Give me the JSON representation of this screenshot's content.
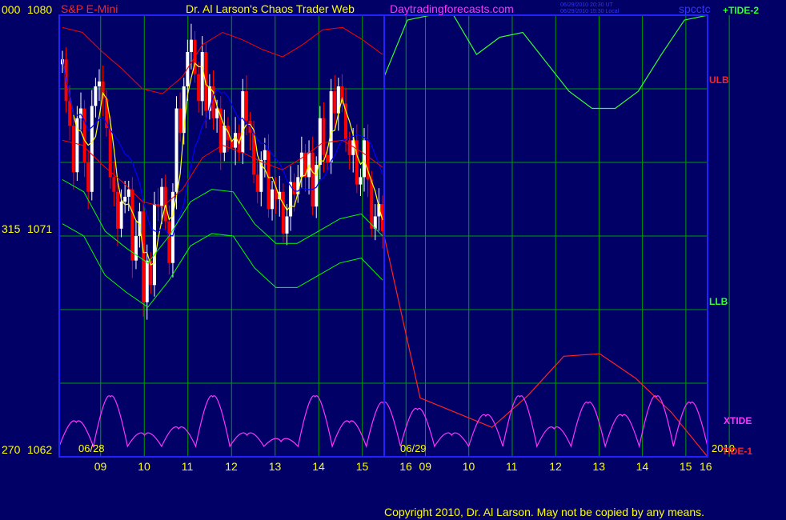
{
  "header": {
    "symbol": "S&P E-Mini",
    "title": "Dr. Al Larson's Chaos Trader Web",
    "site": "Daytradingforecasts.com",
    "timestamp_ut": "06/29/2010 20:30 UT",
    "timestamp_local": "06/29/2010 15:30 Local",
    "chart_id": "spcctc",
    "tide2_label": "+TIDE-2"
  },
  "footer": {
    "copyright": "Copyright 2010, Dr. Al Larson. May not be copied by any means."
  },
  "colors": {
    "background": "#000066",
    "grid": "#00a000",
    "frame": "#2222ff",
    "price_up": "#ffffff",
    "price_down": "#ff0000",
    "avg_fast": "#ffff00",
    "avg_slow": "#0000ff",
    "ulb": "#ff0000",
    "llb": "#00ff00",
    "tide2": "#33ff33",
    "tide1": "#ff2222",
    "xtide": "#ff33ff",
    "axis_text": "#ffff00",
    "copyright": "#ffff00"
  },
  "chart_data": {
    "type": "line",
    "y_axis": {
      "labels_left_inner": [
        "1080",
        "1071",
        "1062"
      ],
      "labels_left_outer": [
        "000",
        "315",
        "270"
      ],
      "ylim": [
        1062,
        1080
      ]
    },
    "x_axis": {
      "dates": [
        "06/28",
        "06/29"
      ],
      "year": "2010",
      "hour_ticks": [
        "09",
        "10",
        "11",
        "12",
        "13",
        "14",
        "15",
        "16",
        "09",
        "10",
        "11",
        "12",
        "13",
        "14",
        "15",
        "16"
      ]
    },
    "right_labels": [
      "+TIDE-2",
      "ULB",
      "LLB",
      "XTIDE",
      "TIDE-1"
    ],
    "price_close": [
      1078.2,
      1076.5,
      1075.5,
      1073.6,
      1075.8,
      1076.2,
      1074.0,
      1072.8,
      1076.3,
      1077.1,
      1077.3,
      1076.6,
      1075.4,
      1073.4,
      1072.8,
      1071.3,
      1072.4,
      1072.6,
      1072.9,
      1070.0,
      1071.0,
      1072.0,
      1068.3,
      1070.0,
      1069.0,
      1072.3,
      1072.2,
      1073.0,
      1071.6,
      1069.9,
      1072.8,
      1076.2,
      1075.2,
      1077.1,
      1078.5,
      1079.0,
      1077.6,
      1076.5,
      1078.5,
      1076.1,
      1077.1,
      1075.8,
      1076.2,
      1074.4,
      1075.5,
      1074.9,
      1074.6,
      1075.2,
      1074.4,
      1076.9,
      1075.7,
      1075.2,
      1073.5,
      1072.8,
      1074.1,
      1074.5,
      1072.1,
      1072.9,
      1072.5,
      1072.8,
      1071.1,
      1071.8,
      1073.2,
      1072.7,
      1073.4,
      1074.4,
      1073.4,
      1074.4,
      1072.2,
      1073.9,
      1075.8,
      1074.3,
      1074.0,
      1076.9,
      1076.0,
      1077.1,
      1076.4,
      1074.9,
      1074.3,
      1074.9,
      1073.1,
      1073.4,
      1074.9,
      1073.3,
      1071.3,
      1071.8,
      1072.3,
      1071.2
    ],
    "price_open": [
      1078.0,
      1078.2,
      1076.5,
      1075.5,
      1073.6,
      1075.8,
      1076.2,
      1074.0,
      1072.8,
      1076.3,
      1077.1,
      1077.3,
      1076.6,
      1075.4,
      1073.4,
      1072.8,
      1071.3,
      1072.4,
      1072.6,
      1072.9,
      1070.0,
      1071.0,
      1072.0,
      1068.3,
      1070.0,
      1069.0,
      1072.3,
      1072.2,
      1073.0,
      1071.6,
      1069.9,
      1072.8,
      1076.2,
      1075.2,
      1077.1,
      1078.5,
      1079.0,
      1077.6,
      1076.5,
      1078.5,
      1076.1,
      1077.1,
      1075.8,
      1076.2,
      1074.4,
      1075.5,
      1074.9,
      1074.6,
      1075.2,
      1074.4,
      1076.9,
      1075.7,
      1075.2,
      1073.5,
      1072.8,
      1074.1,
      1074.5,
      1072.1,
      1072.9,
      1072.5,
      1072.8,
      1071.1,
      1071.8,
      1073.2,
      1072.7,
      1073.4,
      1074.4,
      1073.4,
      1074.4,
      1072.2,
      1073.9,
      1075.8,
      1074.3,
      1074.0,
      1076.9,
      1076.0,
      1077.1,
      1076.4,
      1074.9,
      1074.3,
      1074.9,
      1073.1,
      1073.4,
      1074.9,
      1073.3,
      1071.3,
      1071.8,
      1072.3
    ],
    "ulb_values": [
      1079.5,
      1079.3,
      1078.5,
      1077.8,
      1077.0,
      1076.8,
      1077.5,
      1078.8,
      1079.3,
      1079.0,
      1078.6,
      1078.3,
      1078.8,
      1079.4,
      1079.5,
      1079.0,
      1078.4
    ],
    "llb_values": [
      1071.5,
      1071.0,
      1069.4,
      1068.7,
      1068.1,
      1069.2,
      1070.6,
      1071.1,
      1071.0,
      1069.7,
      1068.9,
      1068.9,
      1069.4,
      1069.9,
      1070.1,
      1069.2
    ],
    "tide2_values": [
      1077.5,
      1079.8,
      1080.0,
      1080.0,
      1078.4,
      1079.1,
      1079.3,
      1078.1,
      1076.9,
      1076.2,
      1076.2,
      1076.9,
      1078.4,
      1079.8,
      1080.0
    ],
    "tide1_values": [
      1071.0,
      1064.4,
      1063.8,
      1063.2,
      1064.5,
      1066.1,
      1066.2,
      1065.2,
      1063.8,
      1062.0
    ],
    "xtide_peaks": [
      0.5,
      0.9,
      0.3,
      0.4,
      0.9,
      0.3,
      0.2,
      0.9,
      0.5,
      0.8,
      0.7,
      0.3,
      0.6,
      0.9,
      0.4,
      0.8,
      0.6,
      0.9,
      0.8
    ]
  }
}
